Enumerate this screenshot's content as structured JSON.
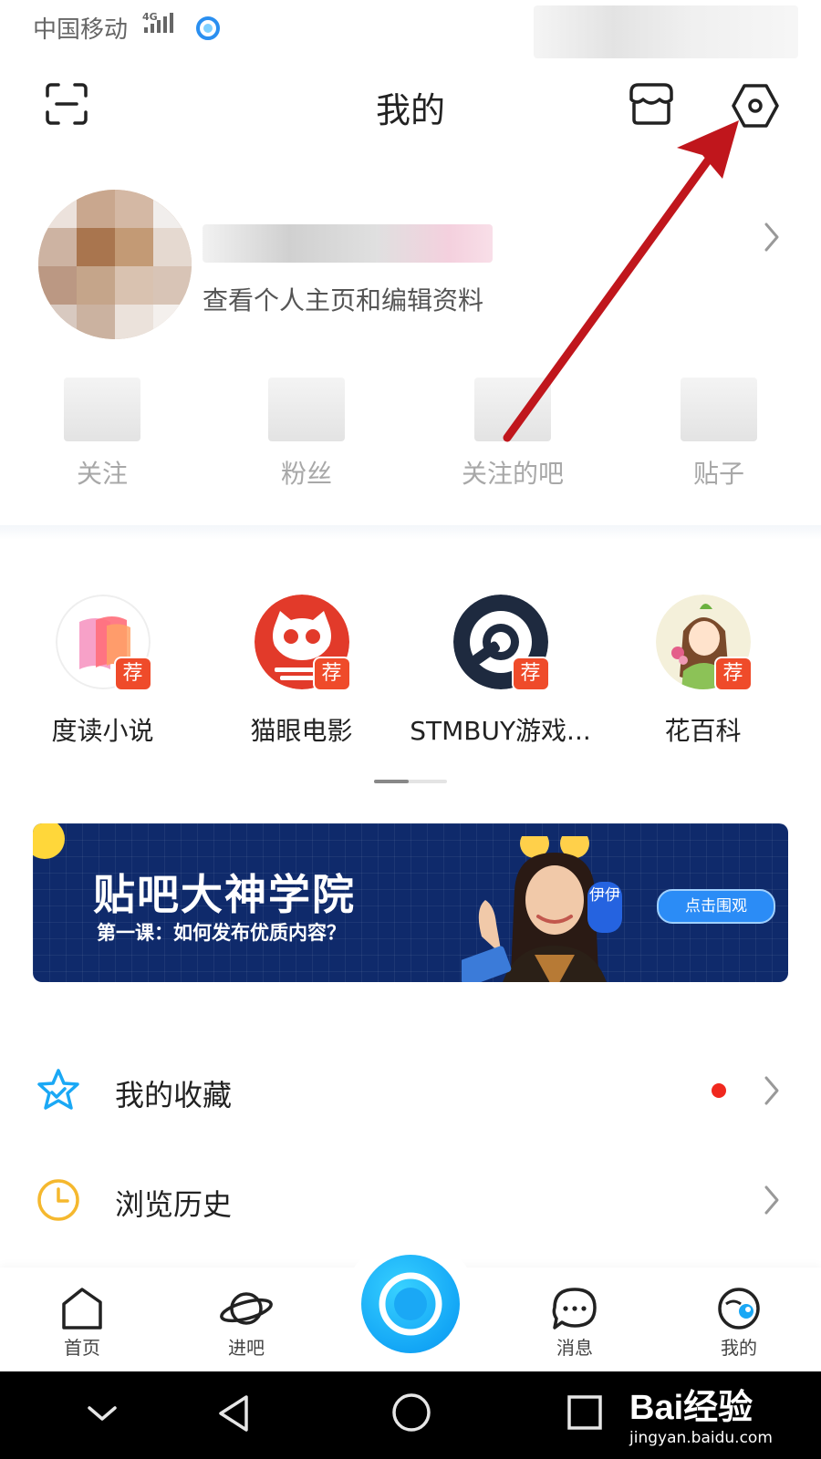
{
  "status_bar": {
    "carrier": "中国移动",
    "network": "4G"
  },
  "header": {
    "title": "我的"
  },
  "profile": {
    "subtitle": "查看个人主页和编辑资料"
  },
  "stats": [
    {
      "label": "关注"
    },
    {
      "label": "粉丝"
    },
    {
      "label": "关注的吧"
    },
    {
      "label": "贴子"
    }
  ],
  "recommended_apps": [
    {
      "name": "度读小说",
      "badge": "荐"
    },
    {
      "name": "猫眼电影",
      "badge": "荐"
    },
    {
      "name": "STMBUY游戏...",
      "badge": "荐"
    },
    {
      "name": "花百科",
      "badge": "荐"
    }
  ],
  "banner": {
    "title": "贴吧大神学院",
    "subtitle": "第一课：如何发布优质内容？",
    "tag": "伊伊",
    "cta": "点击围观"
  },
  "menu": [
    {
      "label": "我的收藏",
      "icon": "star-icon",
      "has_red_dot": true
    },
    {
      "label": "浏览历史",
      "icon": "clock-icon",
      "has_red_dot": false
    }
  ],
  "tabbar": [
    {
      "label": "首页",
      "icon": "home-icon"
    },
    {
      "label": "进吧",
      "icon": "planet-icon"
    },
    {
      "label": "消息",
      "icon": "message-icon"
    },
    {
      "label": "我的",
      "icon": "profile-face-icon"
    }
  ],
  "watermark": {
    "brand": "Bai经验",
    "url": "jingyan.baidu.com"
  },
  "colors": {
    "accent": "#1aa8f5",
    "badge": "#ef4b2a",
    "annotation_arrow": "#c0161c",
    "banner_bg": "#0f2a6b"
  }
}
